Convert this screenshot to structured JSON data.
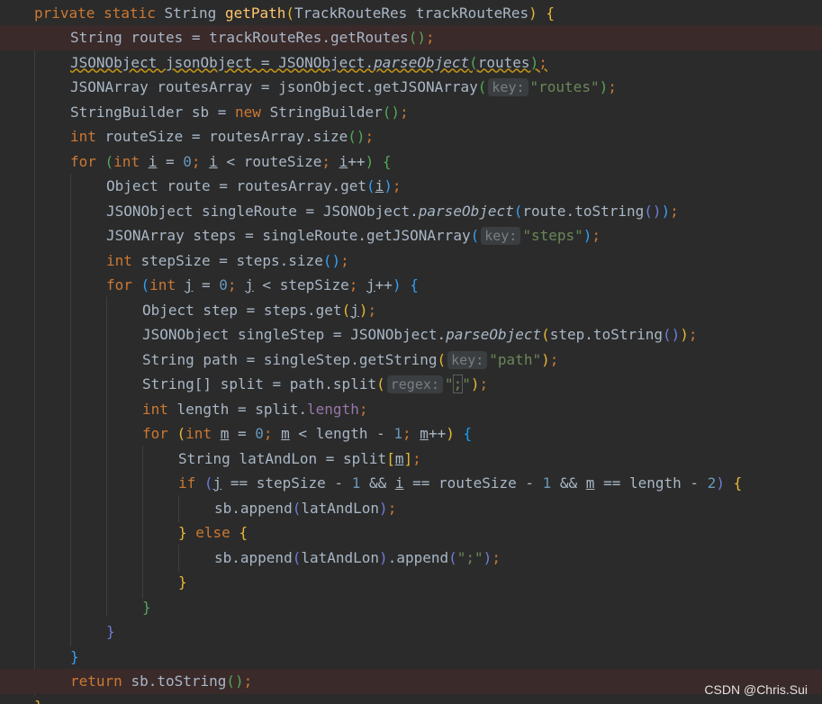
{
  "lines": [
    {
      "id": "l1",
      "tokens": [
        "private",
        "static",
        "String",
        "getPath",
        "(",
        "TrackRouteRes trackRouteRes",
        ")",
        "{"
      ]
    },
    {
      "id": "l2",
      "text": "String routes = trackRouteRes.getRoutes();"
    },
    {
      "id": "l3",
      "text": "JSONObject jsonObject = JSONObject.parseObject(routes);"
    },
    {
      "id": "l4",
      "text": "JSONArray routesArray = jsonObject.getJSONArray(",
      "hint": "key:",
      "str": "\"routes\"",
      "end": ");"
    },
    {
      "id": "l5",
      "text": "StringBuilder sb = new StringBuilder();"
    },
    {
      "id": "l6",
      "text": "int routeSize = routesArray.size();"
    },
    {
      "id": "l7",
      "text": "for (int i = 0; i < routeSize; i++) {"
    },
    {
      "id": "l8",
      "text": "Object route = routesArray.get(i);"
    },
    {
      "id": "l9",
      "text": "JSONObject singleRoute = JSONObject.parseObject(route.toString());"
    },
    {
      "id": "l10",
      "text": "JSONArray steps = singleRoute.getJSONArray(",
      "hint": "key:",
      "str": "\"steps\"",
      "end": ");"
    },
    {
      "id": "l11",
      "text": "int stepSize = steps.size();"
    },
    {
      "id": "l12",
      "text": "for (int j = 0; j < stepSize; j++) {"
    },
    {
      "id": "l13",
      "text": "Object step = steps.get(j);"
    },
    {
      "id": "l14",
      "text": "JSONObject singleStep = JSONObject.parseObject(step.toString());"
    },
    {
      "id": "l15",
      "text": "String path = singleStep.getString(",
      "hint": "key:",
      "str": "\"path\"",
      "end": ");"
    },
    {
      "id": "l16",
      "text": "String[] split = path.split(",
      "hint": "regex:",
      "str": "\";\"",
      "end": ");"
    },
    {
      "id": "l17",
      "text": "int length = split.length;"
    },
    {
      "id": "l18",
      "text": "for (int m = 0; m < length - 1; m++) {"
    },
    {
      "id": "l19",
      "text": "String latAndLon = split[m];"
    },
    {
      "id": "l20",
      "text": "if (j == stepSize - 1 && i == routeSize - 1 && m == length - 2) {"
    },
    {
      "id": "l21",
      "text": "sb.append(latAndLon);"
    },
    {
      "id": "l22",
      "text": "} else {"
    },
    {
      "id": "l23",
      "text": "sb.append(latAndLon).append(\";\");"
    },
    {
      "id": "l24",
      "text": "}"
    },
    {
      "id": "l25",
      "text": "}"
    },
    {
      "id": "l26",
      "text": "}"
    },
    {
      "id": "l27",
      "text": "}"
    },
    {
      "id": "l28",
      "text": "return sb.toString();"
    },
    {
      "id": "l29",
      "text": "}"
    }
  ],
  "watermark": "CSDN @Chris.Sui",
  "colors": {
    "background": "#2b2b2b",
    "keyword": "#cc7832",
    "method": "#ffc66d",
    "number": "#6897bb",
    "string": "#6a8759",
    "field": "#9876aa",
    "text": "#a9b7c6",
    "highlight": "#3a2a2a"
  }
}
